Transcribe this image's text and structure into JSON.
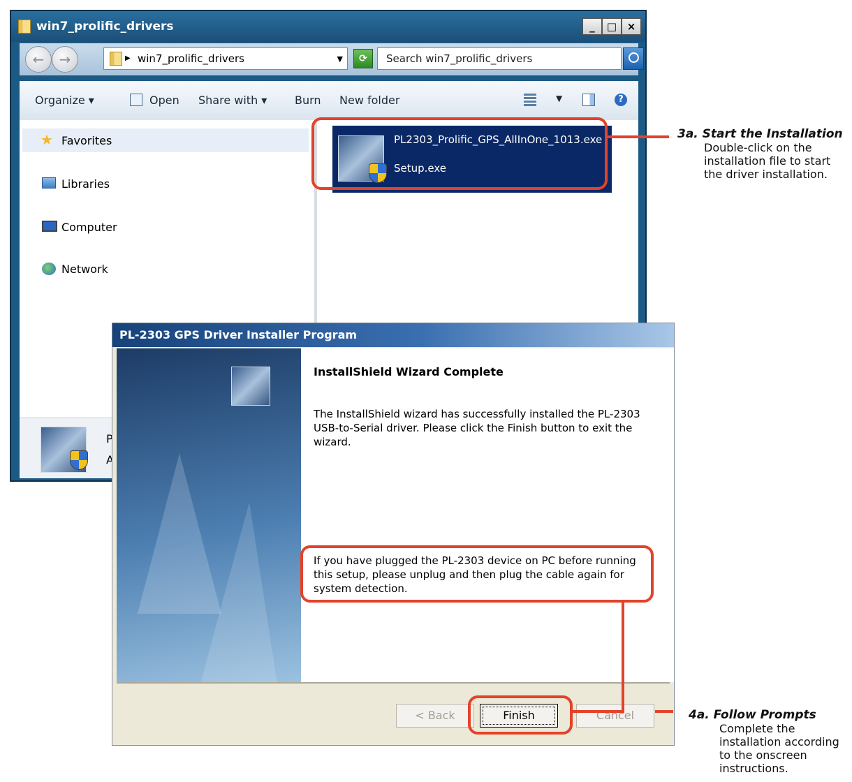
{
  "explorer": {
    "title": "win7_prolific_drivers",
    "address_crumb": "win7_prolific_drivers",
    "search_placeholder": "Search win7_prolific_drivers",
    "window_buttons": [
      "_",
      "□",
      "×"
    ],
    "toolbar": {
      "organize": "Organize",
      "open": "Open",
      "share_with": "Share with",
      "burn": "Burn",
      "new_folder": "New folder"
    },
    "nav": {
      "favorites": "Favorites",
      "libraries": "Libraries",
      "computer": "Computer",
      "network": "Network"
    },
    "selected_file": {
      "name": "PL2303_Prolific_GPS_AllInOne_1013.exe",
      "type": "Setup.exe"
    },
    "details_partial": [
      "P",
      "A"
    ]
  },
  "dialog": {
    "title": "PL-2303 GPS Driver Installer Program",
    "heading": "InstallShield Wizard Complete",
    "body": "The InstallShield wizard has successfully installed the PL-2303 USB-to-Serial driver. Please click the Finish button to exit the wizard.",
    "note": "If you have plugged the PL-2303 device on PC before running this setup, please unplug and then plug the cable again for system detection.",
    "buttons": {
      "back": "< Back",
      "finish": "Finish",
      "cancel": "Cancel"
    }
  },
  "callouts": {
    "step3a": {
      "title": "3a. Start the Installation",
      "description": "Double-click on the installation file to start the driver installation."
    },
    "step4a": {
      "title": "4a. Follow Prompts",
      "description": "Complete the installation according to the onscreen instructions."
    }
  },
  "colors": {
    "highlight": "#e2432a",
    "explorer_frame": "#1c5a86",
    "selection": "#0b2866"
  }
}
